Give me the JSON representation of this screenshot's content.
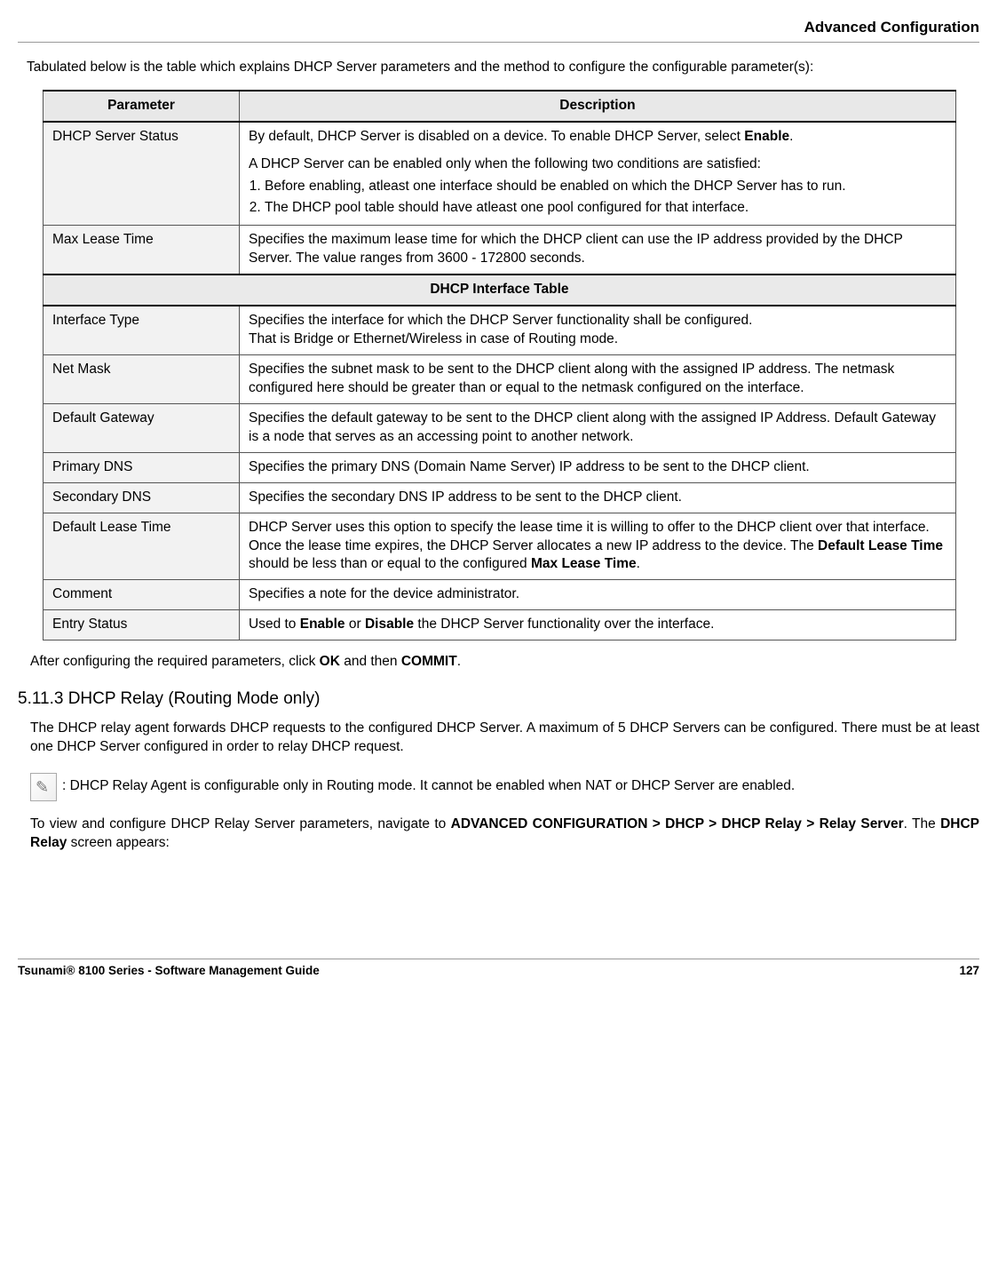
{
  "header": {
    "title": "Advanced Configuration"
  },
  "intro": "Tabulated below is the table which explains DHCP Server parameters and the method to configure the configurable parameter(s):",
  "table": {
    "head_param": "Parameter",
    "head_desc": "Description",
    "subhead": "DHCP Interface Table",
    "rows": [
      {
        "param": "DHCP Server Status",
        "desc_intro_pre": "By default, DHCP Server is disabled on a device. To enable DHCP Server, select ",
        "desc_intro_bold": "Enable",
        "desc_intro_post": ".",
        "cond_intro": "A DHCP Server can be enabled only when the following two conditions are satisfied:",
        "cond_1": "Before enabling, atleast one interface should be enabled on which the DHCP Server has to run.",
        "cond_2": "The DHCP pool table should have atleast one pool configured for that interface."
      },
      {
        "param": "Max Lease Time",
        "desc_plain": "Specifies the maximum lease time for which the DHCP client can use the IP address provided by the DHCP Server. The value ranges from 3600 - 172800 seconds."
      },
      {
        "param": "Interface Type",
        "desc_line1": "Specifies the interface for which the DHCP Server functionality shall be configured.",
        "desc_line2": "That is Bridge or Ethernet/Wireless in case of Routing mode."
      },
      {
        "param": "Net Mask",
        "desc_plain": "Specifies the subnet mask to be sent to the DHCP client along with the assigned IP address. The netmask configured here should be greater than or equal to the netmask configured on the interface."
      },
      {
        "param": "Default Gateway",
        "desc_plain": "Specifies the default gateway to be sent to the DHCP client along with the assigned IP Address. Default Gateway is a node that serves as an accessing point to another network."
      },
      {
        "param": "Primary DNS",
        "desc_plain": "Specifies the primary DNS (Domain Name Server) IP address to be sent to the DHCP client."
      },
      {
        "param": "Secondary DNS",
        "desc_plain": "Specifies the secondary DNS IP address to be sent to the DHCP client."
      },
      {
        "param": "Default Lease Time",
        "dlt_pre": "DHCP Server uses this option to specify the lease time it is willing to offer to the DHCP client over that interface. Once the lease time expires, the DHCP Server allocates a new IP address to the device. The ",
        "dlt_b1": "Default Lease Time",
        "dlt_mid": " should be less than or equal to the configured ",
        "dlt_b2": "Max Lease Time",
        "dlt_post": "."
      },
      {
        "param": "Comment",
        "desc_plain": "Specifies a note for the device administrator."
      },
      {
        "param": "Entry Status",
        "es_pre": "Used to ",
        "es_b1": "Enable",
        "es_mid": " or ",
        "es_b2": "Disable",
        "es_post": " the DHCP Server functionality over the interface."
      }
    ]
  },
  "after_table": {
    "pre": "After configuring the required parameters, click ",
    "b1": "OK",
    "mid": " and then ",
    "b2": "COMMIT",
    "post": "."
  },
  "section": {
    "heading": "5.11.3 DHCP Relay (Routing Mode only)",
    "para": "The DHCP relay agent forwards DHCP requests to the configured DHCP Server. A maximum of 5 DHCP Servers can be configured. There must be at least one DHCP Server configured in order to relay DHCP request.",
    "note": ": DHCP Relay Agent is configurable only in Routing mode. It cannot be enabled when NAT or DHCP Server are enabled.",
    "nav_pre": "To view and configure DHCP Relay Server parameters, navigate to ",
    "nav_b1": "ADVANCED CONFIGURATION > DHCP > DHCP Relay > Relay Server",
    "nav_mid": ". The ",
    "nav_b2": "DHCP Relay",
    "nav_post": " screen appears:"
  },
  "footer": {
    "left": "Tsunami® 8100 Series - Software Management Guide",
    "right": "127"
  }
}
